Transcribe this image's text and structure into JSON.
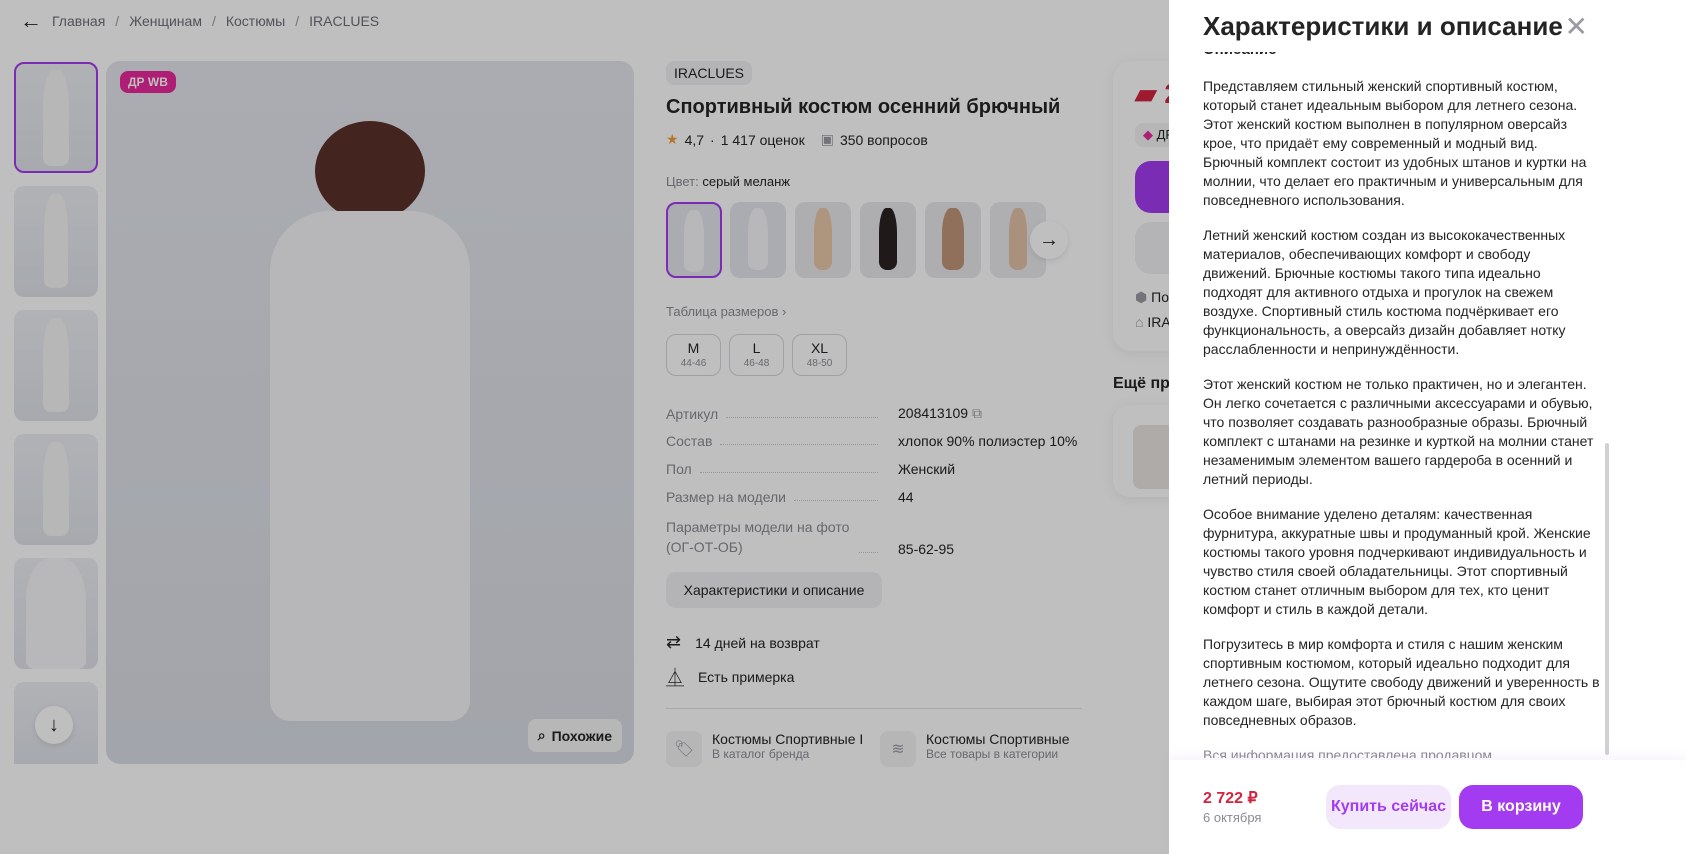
{
  "breadcrumb": [
    "Главная",
    "Женщинам",
    "Костюмы",
    "IRACLUES"
  ],
  "gallery": {
    "badge": "ДР WB",
    "similar": "Похожие"
  },
  "product": {
    "brand": "IRACLUES",
    "title": "Спортивный костюм осенний брючный",
    "rating": "4,7",
    "reviews": "1 417 оценок",
    "questions": "350 вопросов",
    "color_label": "Цвет:",
    "color_value": "серый меланж",
    "size_table": "Таблица размеров",
    "sizes": [
      {
        "size": "M",
        "range": "44-46"
      },
      {
        "size": "L",
        "range": "46-48"
      },
      {
        "size": "XL",
        "range": "48-50"
      }
    ],
    "specs": [
      {
        "k": "Артикул",
        "v": "208413109"
      },
      {
        "k": "Состав",
        "v": "хлопок 90% полиэстер 10%"
      },
      {
        "k": "Пол",
        "v": "Женский"
      },
      {
        "k": "Размер на модели",
        "v": "44"
      },
      {
        "k": "Параметры модели на фото (ОГ-ОТ-ОБ)",
        "v": "85-62-95"
      }
    ],
    "char_button": "Характеристики и описание",
    "returns": "14 дней на возврат",
    "fitting": "Есть примерка",
    "links": [
      {
        "title": "Костюмы Спортивные IRACLUES",
        "sub": "В каталог бренда"
      },
      {
        "title": "Костюмы Спортивные",
        "sub": "Все товары в категории"
      }
    ]
  },
  "side": {
    "price_partial": "2",
    "badge_partial": "ДР W",
    "ship_partial": "Посл",
    "seller_partial": "IRAC",
    "more_partial": "Ещё пред"
  },
  "panel": {
    "title": "Характеристики и описание",
    "section": "Описание",
    "paragraphs": [
      "Представляем стильный женский спортивный костюм, который станет идеальным выбором для летнего сезона. Этот женский костюм выполнен в популярном оверсайз крое, что придаёт ему современный и модный вид. Брючный комплект состоит из удобных штанов и куртки на молнии, что делает его практичным и универсальным для повседневного использования.",
      "Летний женский костюм создан из высококачественных материалов, обеспечивающих комфорт и свободу движений. Брючные костюмы такого типа идеально подходят для активного отдыха и прогулок на свежем воздухе. Спортивный стиль костюма подчёркивает его функциональность, а оверсайз дизайн добавляет нотку расслабленности и непринуждённости.",
      "Этот женский костюм не только практичен, но и элегантен. Он легко сочетается с различными аксессуарами и обувью, что позволяет создавать разнообразные образы. Брючный комплект с штанами на резинке и курткой на молнии станет незаменимым элементом вашего гардероба в осенний и летний периоды.",
      "Особое внимание уделено деталям: качественная фурнитура, аккуратные швы и продуманный крой. Женские костюмы такого уровня подчеркивают индивидуальность и чувство стиля своей обладательницы. Этот спортивный костюм станет отличным выбором для тех, кто ценит комфорт и стиль в каждой детали.",
      "Погрузитесь в мир комфорта и стиля с нашим женским спортивным костюмом, который идеально подходит для летнего сезона. Ощутите свободу движений и уверенность в каждом шаге, выбирая этот брючный костюм для своих повседневных образов."
    ],
    "note": "Вся информация предоставлена продавцом",
    "price": "2 722 ₽",
    "date": "6 октября",
    "buy_now": "Купить сейчас",
    "add_to_cart": "В корзину"
  },
  "colors": {
    "accent": "#a33cf0",
    "price": "#d1243f",
    "badge": "#e8289b"
  }
}
